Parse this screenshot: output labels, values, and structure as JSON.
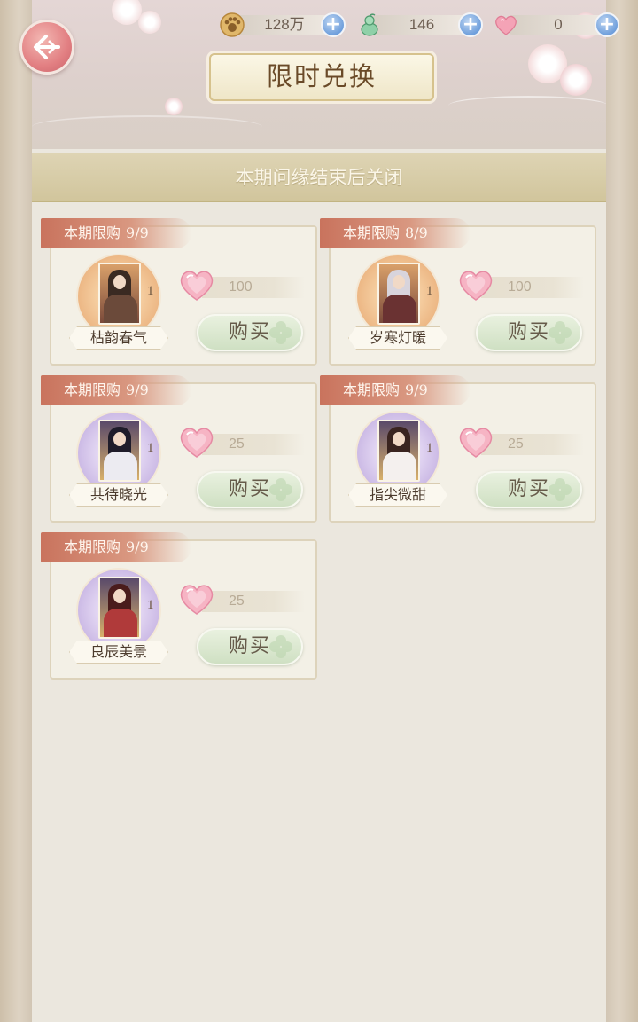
{
  "header": {
    "title": "限时兑换",
    "notice": "本期问缘结束后关闭"
  },
  "currencies": [
    {
      "icon": "paw-coin-icon",
      "value": "128万"
    },
    {
      "icon": "jade-gourd-icon",
      "value": "146"
    },
    {
      "icon": "pink-heart-icon",
      "value": "0"
    }
  ],
  "items": [
    {
      "limit_label": "本期限购",
      "limit_count": "9/9",
      "name": "枯韵春气",
      "qty": "1",
      "price": "100",
      "buy_label": "购买",
      "ring": "orange"
    },
    {
      "limit_label": "本期限购",
      "limit_count": "8/9",
      "name": "岁寒灯暖",
      "qty": "1",
      "price": "100",
      "buy_label": "购买",
      "ring": "orange"
    },
    {
      "limit_label": "本期限购",
      "limit_count": "9/9",
      "name": "共待晓光",
      "qty": "1",
      "price": "25",
      "buy_label": "购买",
      "ring": "purple"
    },
    {
      "limit_label": "本期限购",
      "limit_count": "9/9",
      "name": "指尖微甜",
      "qty": "1",
      "price": "25",
      "buy_label": "购买",
      "ring": "purple"
    },
    {
      "limit_label": "本期限购",
      "limit_count": "9/9",
      "name": "良辰美景",
      "qty": "1",
      "price": "25",
      "buy_label": "购买",
      "ring": "purple"
    }
  ],
  "colors": {
    "accent_tag": "#c9735d",
    "buy_button": "#cfe0c3",
    "notice_band": "#d1c59c"
  }
}
